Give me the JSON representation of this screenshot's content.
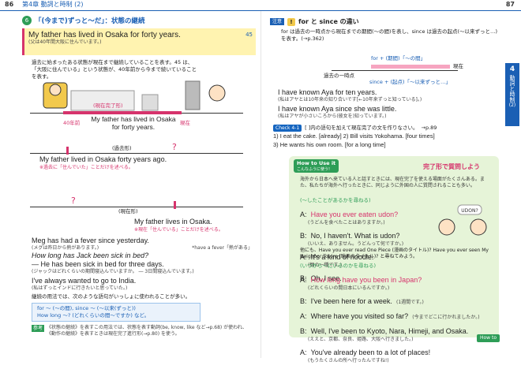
{
  "header": {
    "page_left": "86",
    "chapter": "第4章 動詞と時制 (2)",
    "page_right": "87"
  },
  "left": {
    "section_num": "6",
    "section_title": "「(今まで)ずっと〜だ」：状態の継続",
    "ex45_en": "My father has lived in Osaka for forty years.",
    "ex45_jp": "(父は40年間大阪に住んでいます。)",
    "ex45_num": "45",
    "explain": "過去に始まったある状態が現在まで継続していることを表す。45 は、「大阪に住んでいる」という状態が、40年前から今まで続いていることを表す。",
    "label_present_perfect": "(現在完了形)",
    "label_40years": "40年前",
    "label_now": "現在",
    "tl1_text": "My father has lived in Osaka for forty years.",
    "label_past": "(過去形)",
    "tl2_text": "My father lived in Osaka forty years ago.",
    "tl2_note": "※過去に「住んでいた」ことだけを述べる。",
    "label_present": "(現在形)",
    "tl3_text": "My father lives in Osaka.",
    "tl3_note": "※現在「住んでいる」ことだけを述べる。",
    "examples": [
      {
        "en": "Meg has had a fever since yesterday.",
        "jp": "(メグは昨日から熱があります。)",
        "side": "*have a fever「熱がある」"
      },
      {
        "en": "How long has Jack been sick in bed?",
        "jp": ""
      },
      {
        "en": "— He has been sick in bed for three days.",
        "jp": "(ジャックはどれくらいの期間寝込んでいますか。 ― 3日間寝込んでいます。)"
      },
      {
        "en": "I've always wanted to go to India.",
        "jp": "(私はずっとインドに行きたいと思っていた。)"
      }
    ],
    "tip_title": "継続の用法では、次のような語句がいっしょに使われることが多い。",
    "tip_line1": "for 〜 (〜の間), since 〜 (〜以来(ずっと))",
    "tip_line2": "How long 〜? (どれくらいの間〜ですか) など。",
    "note": "《状態の継続》を表すこの用法では、状態を表す動詞(be, know, like など→p.68) が使われ、《動作の継続》を表すときは現在完了進行形(→p.80) を使う。",
    "note_label": "参考"
  },
  "right": {
    "caution_label": "注意",
    "caution_title": "for と since の違い",
    "caution_text": "for は過去の一時点から現在までの期間(〜の間)を表し、since は過去の起点(〜以来ずっと…)を表す。(→p.362)",
    "diag_for": "for + (期間)「〜の間」",
    "diag_point": "過去の一時点",
    "diag_since": "since + (起点)「〜以来ずっと…」",
    "diag_now": "現在",
    "ex1_en": "I have known Aya for ten years.",
    "ex1_jp": "(私はアヤとは10年来の知り合いです[←10年来ずっと知っている]。)",
    "ex2_en": "I have known Aya since she was little.",
    "ex2_jp": "(私はアヤが小さいころから(彼女を)知っています。)",
    "check_label": "Check 4-1",
    "check_text": "[ ]内の語句を加えて現在完了の文を作りなさい。",
    "check_ref": "→p.89",
    "check_items": "1) I eat the cake. [already]   2) Bill visits Yokohama. [four times]",
    "check_item3": "3) He wants his own room. [for a long time]",
    "howto_label": "How to Use it",
    "howto_sub": "こんなふうに使う!",
    "howto_title": "完了形で質問しよう",
    "howto_intro": "海外から日本へ来ている人と話すときには、現在完了を使える場面がたくさんある。また、私たちが海外へ行ったときに、同じように外国の人に質問されることも多い。",
    "subhead1": "(〜したことがあるかを尋ねる)",
    "dialog1": [
      {
        "sp": "A:",
        "line": "Have you ever eaten udon?",
        "jp": "(うどんを食べたことはありますか。)"
      },
      {
        "sp": "B:",
        "line": "No, I haven't. What is udon?",
        "jp": "(いいえ、ありません。うどんって何ですか。)"
      },
      {
        "sp": "A:",
        "line": "It's a kind of noodle.",
        "jp": "(麺の一種です。)"
      },
      {
        "sp": "B:",
        "line": "Oh, I see.",
        "jp": "(ああ、そうですか。)"
      }
    ],
    "other_line": "他にも、Have you ever read One Piece (漫画のタイトル)? Have you ever seen My Neighbor Totoro (映画のタイトル)? と尋ねてみよう。",
    "subhead2": "(いつから〜にいるのかを尋ねる)",
    "dialog2": [
      {
        "sp": "A:",
        "line": "How long have you been in Japan?",
        "jp": "(どれくらいの間日本にいるんですか。)"
      },
      {
        "sp": "B:",
        "line": "I've been here for a week.",
        "jp": "(1週間です。)"
      },
      {
        "sp": "A:",
        "line": "Where have you visited so far?",
        "jp": "(今までどこに行かれましたか。)"
      },
      {
        "sp": "B:",
        "line": "Well, I've been to Kyoto, Nara, Himeji, and Osaka.",
        "jp": "(ええと、京都、奈良、姫路、大阪へ行きました。)"
      },
      {
        "sp": "A:",
        "line": "You've already been to a lot of places!",
        "jp": "(もうたくさんの所へ行ったんですね!)"
      }
    ],
    "udon_label": "UDON?",
    "howto_footer": "How to",
    "side_tab_num": "4",
    "side_tab_text": "動詞と時制",
    "side_tab_sub": "(2)"
  },
  "colors": {
    "pink": "#d6336c",
    "blue": "#1a5fb4",
    "green": "#2e9d57",
    "yellow": "#fff3b0",
    "lightgreen": "#e6f4d8"
  }
}
